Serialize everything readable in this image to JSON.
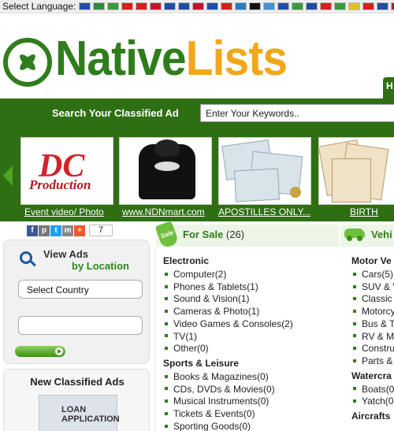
{
  "language_bar": {
    "label": "Select Language:",
    "flags": [
      "#1f4ea3",
      "#2e8b3a",
      "#3a9a3a",
      "#d91e1e",
      "#d91e1e",
      "#c8102e",
      "#1f4ea3",
      "#1f4ea3",
      "#c8102e",
      "#1f4ea3",
      "#d91e1e",
      "#2a7ac0",
      "#111111",
      "#4a90d9",
      "#1f4ea3",
      "#3a9a3a",
      "#1f4ea3",
      "#d91e1e",
      "#3a9a3a",
      "#e0c020",
      "#d91e1e",
      "#1f4ea3",
      "#c8102e"
    ]
  },
  "header": {
    "logo_native": "Native",
    "logo_lists": "Lists",
    "home_tab": "H"
  },
  "search": {
    "label": "Search Your Classified Ad",
    "value": "Enter Your Keywords.."
  },
  "carousel": [
    {
      "caption": "Event video/ Photo",
      "art_line1": "DC",
      "art_line2": "Production"
    },
    {
      "caption": "www.NDNmart.com"
    },
    {
      "caption": "APOSTILLES ONLY..."
    },
    {
      "caption": "BIRTH"
    }
  ],
  "share": {
    "buttons": [
      "f",
      "p",
      "t",
      "m",
      "+"
    ],
    "count": "7"
  },
  "view_ads": {
    "title": "View Ads",
    "subtitle": "by Location",
    "country_select": "Select Country"
  },
  "new_ads": {
    "title": "New Classified Ads",
    "thumb_text_1": "LOAN",
    "thumb_text_2": "APPLICATION"
  },
  "for_sale": {
    "tag": "Sale",
    "title": "For Sale",
    "count": "(26)",
    "categories": [
      {
        "name": "Electronic",
        "items": [
          {
            "label": "Computer",
            "count": "(2)"
          },
          {
            "label": "Phones & Tablets",
            "count": "(1)"
          },
          {
            "label": "Sound & Vision",
            "count": "(1)"
          },
          {
            "label": "Cameras & Photo",
            "count": "(1)"
          },
          {
            "label": "Video Games & Consoles",
            "count": "(2)"
          },
          {
            "label": "TV",
            "count": "(1)"
          },
          {
            "label": "Other",
            "count": "(0)"
          }
        ]
      },
      {
        "name": "Sports & Leisure",
        "items": [
          {
            "label": "Books & Magazines",
            "count": "(0)"
          },
          {
            "label": "CDs, DVDs & Movies",
            "count": "(0)"
          },
          {
            "label": "Musical Instruments",
            "count": "(0)"
          },
          {
            "label": "Tickets & Events",
            "count": "(0)"
          },
          {
            "label": "Sporting Goods",
            "count": "(0)"
          }
        ]
      }
    ]
  },
  "vehicles": {
    "title": "Vehi",
    "categories": [
      {
        "name": "Motor Ve",
        "items": [
          {
            "label": "Cars",
            "count": "(5)"
          },
          {
            "label": "SUV & V",
            "count": ""
          },
          {
            "label": "Classic",
            "count": ""
          },
          {
            "label": "Motorcy",
            "count": ""
          },
          {
            "label": "Bus & T",
            "count": ""
          },
          {
            "label": "RV & M",
            "count": ""
          },
          {
            "label": "Constru",
            "count": ""
          },
          {
            "label": "Parts &",
            "count": ""
          }
        ]
      },
      {
        "name": "Watercra",
        "items": [
          {
            "label": "Boats",
            "count": "(0)"
          },
          {
            "label": "Yatch",
            "count": "(0)"
          }
        ]
      },
      {
        "name": "Aircrafts",
        "items": []
      }
    ]
  }
}
